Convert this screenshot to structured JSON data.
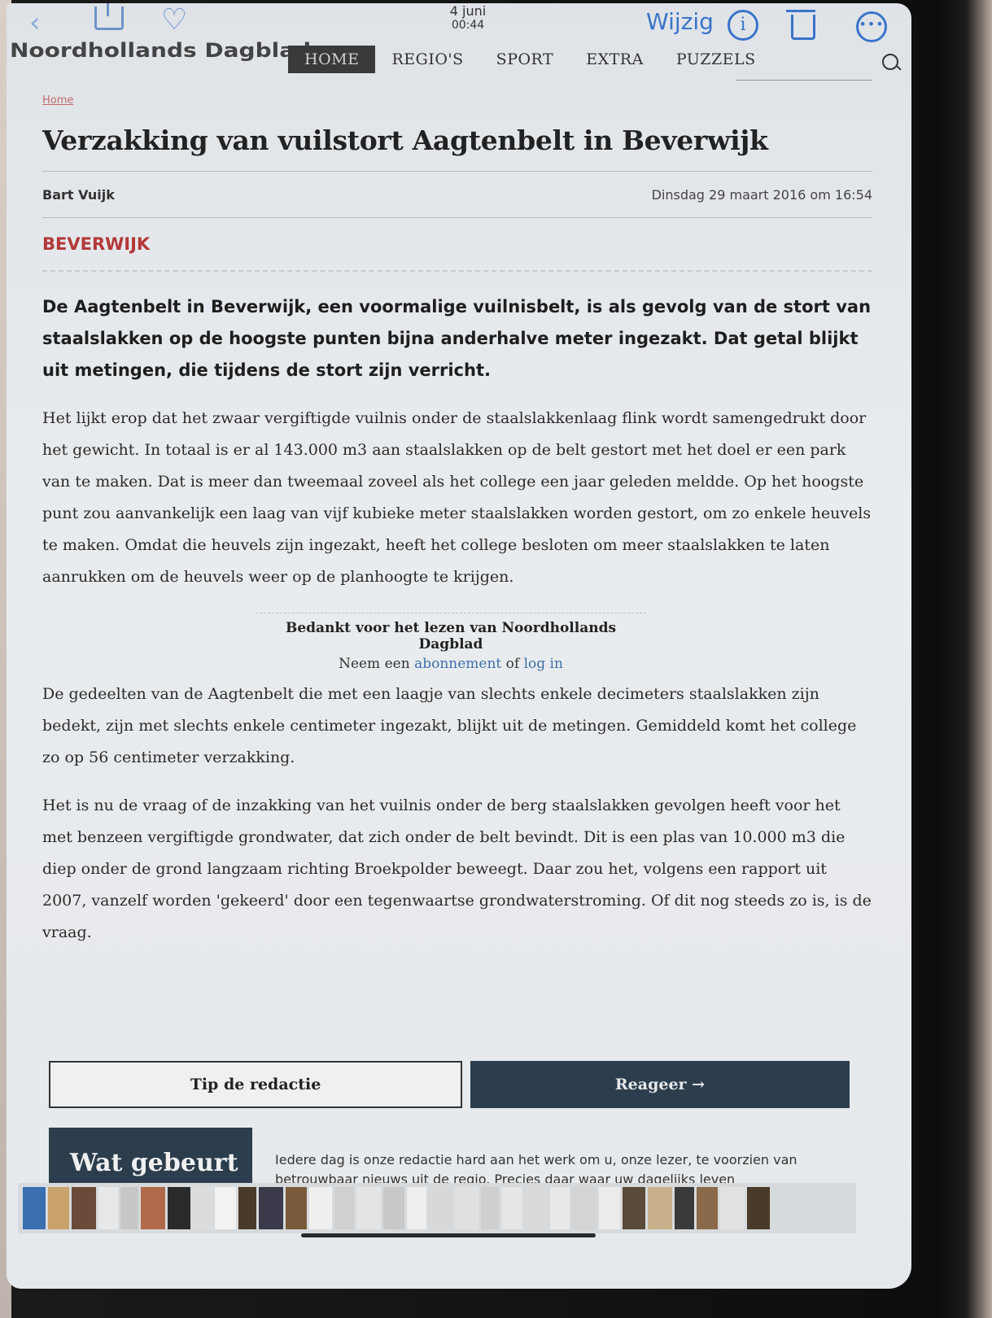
{
  "ios_toolbar": {
    "date": "4 juni",
    "time": "00:44",
    "edit_label": "Wijzig"
  },
  "site": {
    "logo": "Noordhollands Dagblad",
    "nav": [
      "HOME",
      "REGIO'S",
      "SPORT",
      "EXTRA",
      "PUZZELS"
    ],
    "active_nav": "HOME"
  },
  "article": {
    "breadcrumb": "Home",
    "title": "Verzakking van vuilstort Aagtenbelt in Beverwijk",
    "author": "Bart Vuijk",
    "date": "Dinsdag 29 maart 2016 om 16:54",
    "location": "BEVERWIJK",
    "lead": "De Aagtenbelt in Beverwijk, een voormalige vuilnisbelt, is als gevolg van de stort van staalslakken op de hoogste punten bijna anderhalve meter ingezakt. Dat getal blijkt uit metingen, die tijdens de stort zijn verricht.",
    "para1": "Het lijkt erop dat het zwaar vergiftigde vuilnis onder de staalslakkenlaag flink wordt samengedrukt door het gewicht. In totaal is er al 143.000 m3 aan staalslakken op de belt gestort met het doel er een park van te maken. Dat is meer dan tweemaal zoveel als het college een jaar geleden meldde. Op het hoogste punt zou aanvankelijk een laag van vijf kubieke meter staalslakken worden gestort, om zo enkele heuvels te maken. Omdat die heuvels zijn ingezakt, heeft het college besloten om meer staalslakken te laten aanrukken om de heuvels weer op de planhoogte te krijgen.",
    "paywall_line1": "Bedankt voor het lezen van Noordhollands Dagblad",
    "paywall_prefix": "Neem een",
    "paywall_link1": "abonnement",
    "paywall_mid": "of",
    "paywall_link2": "log in",
    "para2": "De gedeelten van de Aagtenbelt die met een laagje van slechts enkele decimeters staalslakken zijn bedekt, zijn met slechts enkele centimeter ingezakt, blijkt uit de metingen. Gemiddeld komt het college zo op 56 centimeter verzakking.",
    "para3": "Het is nu de vraag of de inzakking van het vuilnis onder de berg staalslakken gevolgen heeft voor het met benzeen vergiftigde grondwater, dat zich onder de belt bevindt. Dit is een plas van 10.000 m3 die diep onder de grond langzaam richting Broekpolder beweegt. Daar zou het, volgens een rapport uit 2007, vanzelf worden 'gekeerd' door een tegenwaartse grondwaterstroming. Of dit nog steeds zo is, is de vraag."
  },
  "actions": {
    "tip": "Tip de redactie",
    "react": "Reageer →"
  },
  "promo": {
    "title": "Wat gebeurt",
    "text": "Iedere dag is onze redactie hard aan het werk om u, onze lezer, te voorzien van betrouwbaar nieuws uit de regio. Precies daar waar uw dagelijks leven"
  },
  "thumbnail_colors": [
    "#3a6fb0",
    "#c9a36b",
    "#6b4a3a",
    "#e8e8e8",
    "#c7c7c7",
    "#b06a4a",
    "#2a2a2a",
    "#dcdcdc",
    "#f2f2f2",
    "#4a3a2a",
    "#3a3a4a",
    "#7a5a3a",
    "#efefef",
    "#d0d0d0",
    "#e4e4e4",
    "#c8c8c8",
    "#eeeeee",
    "#d8d8d8",
    "#e0e0e0",
    "#cfcfcf",
    "#e6e6e6",
    "#dadada",
    "#e9e9e9",
    "#d4d4d4",
    "#ececec",
    "#5a4a3a",
    "#c8b08a",
    "#3a3a3a",
    "#8a6a4a",
    "#e2e2e2",
    "#4a3a2a"
  ]
}
